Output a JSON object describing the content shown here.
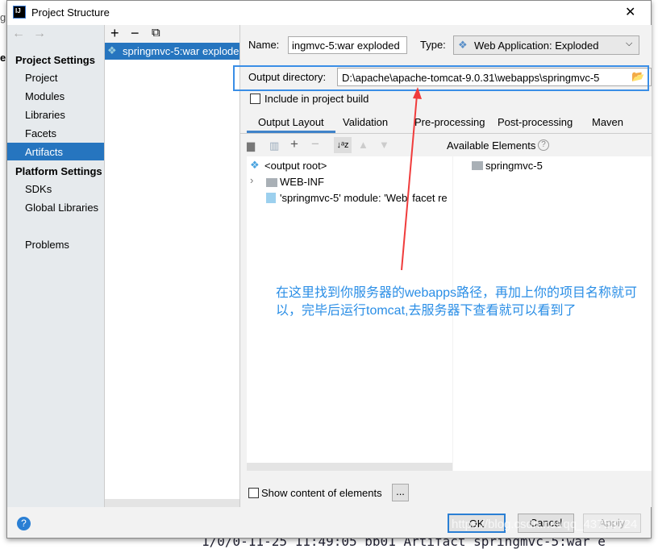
{
  "background": {
    "left_char": "g",
    "left_char2": "e",
    "log_line": "1/0/0-11-25 11:49:05 bb01 Artifact springmvc-5:war e"
  },
  "window": {
    "title": "Project Structure",
    "close": "✕"
  },
  "sidebar": {
    "project_settings": "Project Settings",
    "items": [
      "Project",
      "Modules",
      "Libraries",
      "Facets",
      "Artifacts"
    ],
    "selected": "Artifacts",
    "platform_settings": "Platform Settings",
    "platform_items": [
      "SDKs",
      "Global Libraries"
    ],
    "problems": "Problems"
  },
  "artifacts": {
    "add": "+",
    "remove": "−",
    "copy": "⧉",
    "items": [
      "springmvc-5:war exploded"
    ]
  },
  "form": {
    "name_label": "Name:",
    "name_value": "ingmvc-5:war exploded",
    "type_label": "Type:",
    "type_value": "Web Application: Exploded",
    "output_label": "Output directory:",
    "output_value": "D:\\apache\\apache-tomcat-9.0.31\\webapps\\springmvc-5",
    "include_label": "Include in project build"
  },
  "tabs": [
    "Output Layout",
    "Validation",
    "Pre-processing",
    "Post-processing",
    "Maven"
  ],
  "active_tab": "Output Layout",
  "layout_tree": [
    {
      "label": "<output root>",
      "icon": "artifact-icon"
    },
    {
      "label": "WEB-INF",
      "icon": "folder-icon"
    },
    {
      "label": "'springmvc-5' module: 'Web' facet re",
      "icon": "web-facet-icon"
    }
  ],
  "available": {
    "title": "Available Elements",
    "help": "?",
    "items": [
      "springmvc-5"
    ]
  },
  "show_content": "Show content of elements",
  "ellipsis": "...",
  "buttons": {
    "ok": "OK",
    "cancel": "Cancel",
    "apply": "Apply",
    "help": "?"
  },
  "annotation": {
    "text": "在这里找到你服务器的webapps路径，再加上你的项目名称就可以，完毕后运行tomcat,去服务器下查看就可以看到了",
    "box_color": "#3a8ee6",
    "arrow_color": "#f03c3c"
  },
  "watermark": "https://blog.csdn.net/qq_43753724"
}
